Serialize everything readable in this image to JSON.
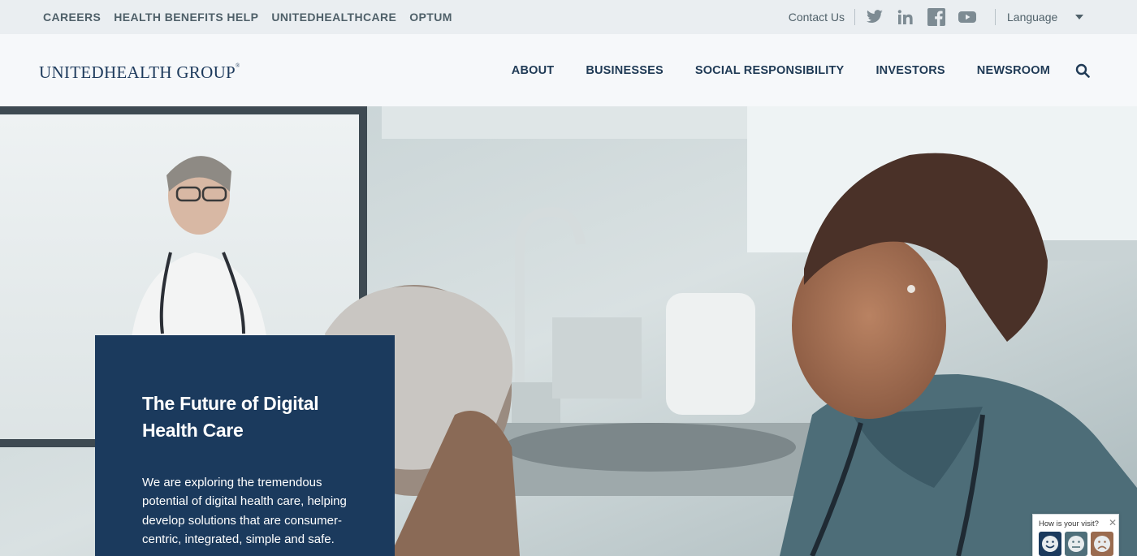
{
  "utility": {
    "links": [
      "CAREERS",
      "HEALTH BENEFITS HELP",
      "UNITEDHEALTHCARE",
      "OPTUM"
    ],
    "contact": "Contact Us",
    "social": [
      "twitter-icon",
      "linkedin-icon",
      "facebook-icon",
      "youtube-icon"
    ],
    "language": "Language"
  },
  "header": {
    "logo": "UNITEDHEALTH GROUP",
    "logo_mark": "®",
    "nav": [
      "ABOUT",
      "BUSINESSES",
      "SOCIAL RESPONSIBILITY",
      "INVESTORS",
      "NEWSROOM"
    ]
  },
  "hero": {
    "title": "The Future of Digital Health Care",
    "text": "We are exploring the tremendous potential of digital health care, helping develop solutions that are consumer-centric, integrated, simple and safe."
  },
  "feedback": {
    "question": "How is your visit?",
    "close": "✕"
  },
  "colors": {
    "navy": "#1b3a5d",
    "utility_bg": "#eaeef1",
    "header_bg": "#f6f8fa"
  }
}
